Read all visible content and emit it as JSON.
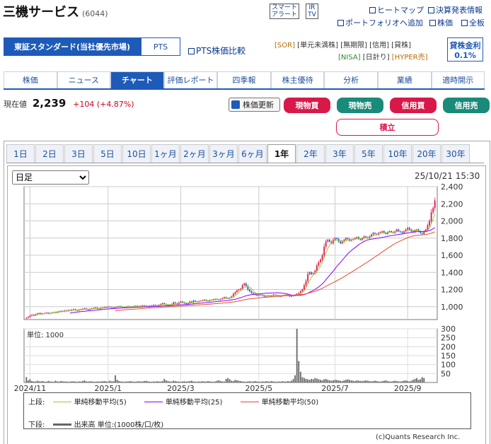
{
  "header": {
    "company": "三機サービス",
    "code": "(6044)",
    "smart_alert": [
      "スマート",
      "アラート"
    ],
    "ir_tv": [
      "IR",
      "TV"
    ],
    "links": [
      "ヒートマップ",
      "決算発表情報",
      "ポートフォリオへ追加",
      "株価",
      "全板"
    ]
  },
  "market": {
    "tabs": [
      "東証スタンダード(当社優先市場)",
      "PTS"
    ],
    "pts_compare": "PTS株価比較",
    "badges_row1": [
      "[SOR]",
      "[単元未満株]",
      "[無期限]",
      "[信用]",
      "[貸株]"
    ],
    "badges_row2": [
      "[NISA]",
      "[日計り]",
      "[HYPER売]"
    ],
    "lending_label": "貸株金利",
    "lending_rate": "0.1%"
  },
  "nav": [
    "株価",
    "ニュース",
    "チャート",
    "評価レポート",
    "四季報",
    "株主優待",
    "分析",
    "業績",
    "適時開示"
  ],
  "quote": {
    "label": "現在値",
    "price": "2,239",
    "change": "+104 (+4.87%)",
    "update_label": "株価更新",
    "buttons": [
      "現物買",
      "現物売",
      "信用買",
      "信用売"
    ],
    "tsumitate": "積立"
  },
  "periods": [
    "1日",
    "2日",
    "3日",
    "5日",
    "10日",
    "1ヶ月",
    "2ヶ月",
    "3ヶ月",
    "6ヶ月",
    "1年",
    "2年",
    "3年",
    "5年",
    "10年",
    "20年",
    "30年"
  ],
  "chart_ctrl": {
    "interval": "日足",
    "timestamp": "25/10/21 15:30"
  },
  "colors": {
    "ma5": "#9acd32",
    "ma25": "#8b00ff",
    "ma50": "#e8492a",
    "up": "#d9184a",
    "down": "#2255cc",
    "volume": "#666666"
  },
  "chart_data": {
    "type": "candlestick",
    "price_ylim": [
      850,
      2400
    ],
    "price_ticks": [
      "2,400",
      "2,200",
      "2,000",
      "1,800",
      "1,600",
      "1,400",
      "1,200",
      "1,000"
    ],
    "price_tick_values": [
      2400,
      2200,
      2000,
      1800,
      1600,
      1400,
      1200,
      1000
    ],
    "volume_label": "単位: 1000",
    "volume_ylim": [
      0,
      300
    ],
    "volume_ticks": [
      "300",
      "250",
      "200",
      "150",
      "100",
      "50"
    ],
    "volume_tick_values": [
      300,
      250,
      200,
      150,
      100,
      50
    ],
    "x_ticks": [
      "2024/11",
      "2025/1",
      "2025/3",
      "2025/5",
      "2025/7",
      "2025/9"
    ],
    "x_tick_index": [
      2,
      45,
      85,
      128,
      170,
      210
    ],
    "close": [
      870,
      880,
      895,
      905,
      900,
      910,
      920,
      925,
      915,
      920,
      925,
      930,
      920,
      925,
      930,
      935,
      930,
      940,
      945,
      950,
      945,
      955,
      950,
      960,
      955,
      965,
      970,
      960,
      955,
      965,
      970,
      975,
      980,
      970,
      965,
      975,
      980,
      985,
      990,
      980,
      975,
      985,
      990,
      995,
      990,
      1000,
      995,
      990,
      985,
      995,
      1000,
      1005,
      1000,
      995,
      990,
      1000,
      1005,
      1000,
      995,
      1005,
      1010,
      1005,
      1000,
      1010,
      1015,
      1010,
      1005,
      1000,
      1010,
      1015,
      1020,
      1015,
      1010,
      1020,
      1030,
      1040,
      1030,
      1020,
      1010,
      1020,
      1030,
      1050,
      1040,
      1030,
      1050,
      1060,
      1050,
      1040,
      1030,
      1040,
      1060,
      1050,
      1070,
      1060,
      1055,
      1065,
      1070,
      1075,
      1080,
      1070,
      1065,
      1075,
      1080,
      1085,
      1090,
      1085,
      1080,
      1090,
      1100,
      1110,
      1100,
      1095,
      1105,
      1120,
      1150,
      1170,
      1190,
      1200,
      1210,
      1250,
      1270,
      1240,
      1200,
      1180,
      1160,
      1150,
      1140,
      1130,
      1135,
      1140,
      1130,
      1120,
      1125,
      1130,
      1120,
      1130,
      1140,
      1135,
      1130,
      1120,
      1125,
      1130,
      1135,
      1140,
      1130,
      1120,
      1125,
      1130,
      1140,
      1150,
      1160,
      1180,
      1200,
      1250,
      1300,
      1380,
      1400,
      1380,
      1390,
      1420,
      1480,
      1520,
      1550,
      1600,
      1700,
      1760,
      1780,
      1760,
      1740,
      1780,
      1800,
      1790,
      1760,
      1740,
      1760,
      1780,
      1800,
      1790,
      1770,
      1780,
      1790,
      1800,
      1810,
      1790,
      1780,
      1800,
      1820,
      1810,
      1800,
      1820,
      1840,
      1860,
      1850,
      1840,
      1860,
      1870,
      1880,
      1860,
      1850,
      1870,
      1880,
      1870,
      1860,
      1880,
      1900,
      1880,
      1870,
      1860,
      1880,
      1900,
      1920,
      1900,
      1880,
      1870,
      1890,
      1900,
      1880,
      1860,
      1850,
      1880,
      1900,
      1950,
      2000,
      2100,
      2150,
      2239
    ],
    "volume": [
      30,
      12,
      18,
      8,
      6,
      5,
      10,
      7,
      6,
      8,
      5,
      4,
      9,
      6,
      5,
      4,
      10,
      6,
      5,
      8,
      7,
      5,
      6,
      4,
      5,
      6,
      7,
      5,
      4,
      6,
      5,
      8,
      12,
      6,
      5,
      7,
      6,
      5,
      4,
      6,
      5,
      6,
      7,
      8,
      6,
      5,
      10,
      6,
      7,
      40,
      15,
      8,
      6,
      5,
      4,
      6,
      5,
      8,
      6,
      5,
      4,
      6,
      7,
      5,
      6,
      8,
      10,
      6,
      5,
      4,
      6,
      5,
      7,
      6,
      5,
      8,
      20,
      12,
      8,
      6,
      5,
      10,
      8,
      6,
      5,
      4,
      6,
      7,
      5,
      6,
      8,
      10,
      6,
      5,
      4,
      6,
      5,
      7,
      6,
      5,
      8,
      6,
      5,
      4,
      6,
      10,
      12,
      8,
      6,
      5,
      20,
      25,
      18,
      10,
      8,
      15,
      12,
      10,
      8,
      6,
      5,
      4,
      6,
      7,
      5,
      6,
      8,
      6,
      5,
      4,
      6,
      5,
      7,
      6,
      5,
      8,
      6,
      5,
      4,
      6,
      5,
      7,
      6,
      5,
      8,
      6,
      10,
      20,
      40,
      300,
      120,
      60,
      30,
      25,
      20,
      18,
      15,
      20,
      18,
      25,
      22,
      18,
      15,
      12,
      18,
      20,
      15,
      12,
      10,
      12,
      15,
      14,
      12,
      10,
      8,
      12,
      15,
      18,
      14,
      12,
      10,
      8,
      12,
      10,
      9,
      8,
      10,
      12,
      10,
      8,
      6,
      8,
      10,
      8,
      6,
      5,
      8,
      10,
      12,
      8,
      6,
      5,
      8,
      10,
      8,
      6,
      5,
      8,
      10,
      12,
      8,
      6,
      10,
      15,
      20,
      25,
      15,
      18,
      30,
      25
    ],
    "legend": {
      "upper_label": "上段:",
      "lower_label": "下段:",
      "series": [
        "単純移動平均(5)",
        "単純移動平均(25)",
        "単純移動平均(50)"
      ],
      "volume_series": "出来高 単位:(1000株/口/枚)"
    },
    "credit": "(c)Quants Research Inc."
  }
}
